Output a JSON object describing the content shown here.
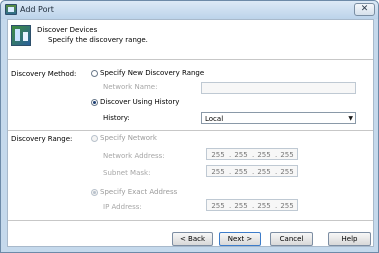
{
  "window": {
    "title": "Add Port",
    "close_symbol": "✕"
  },
  "header": {
    "title": "Discover Devices",
    "subtitle": "Specify the discovery range."
  },
  "discovery_method": {
    "label": "Discovery Method:",
    "option_new": "Specify New Discovery Range",
    "network_name_label": "Network Name:",
    "network_name_value": "",
    "option_history": "Discover Using History",
    "history_label": "History:",
    "history_value": "Local"
  },
  "discovery_range": {
    "label": "Discovery Range:",
    "option_network": "Specify Network",
    "network_address_label": "Network Address:",
    "network_address": [
      "255",
      "255",
      "255",
      "255"
    ],
    "subnet_mask_label": "Subnet Mask:",
    "subnet_mask": [
      "255",
      "255",
      "255",
      "255"
    ],
    "option_exact": "Specify Exact Address",
    "ip_address_label": "IP Address:",
    "ip_address": [
      "255",
      "255",
      "255",
      "255"
    ]
  },
  "buttons": {
    "back": "< Back",
    "next": "Next >",
    "cancel": "Cancel",
    "help": "Help"
  }
}
